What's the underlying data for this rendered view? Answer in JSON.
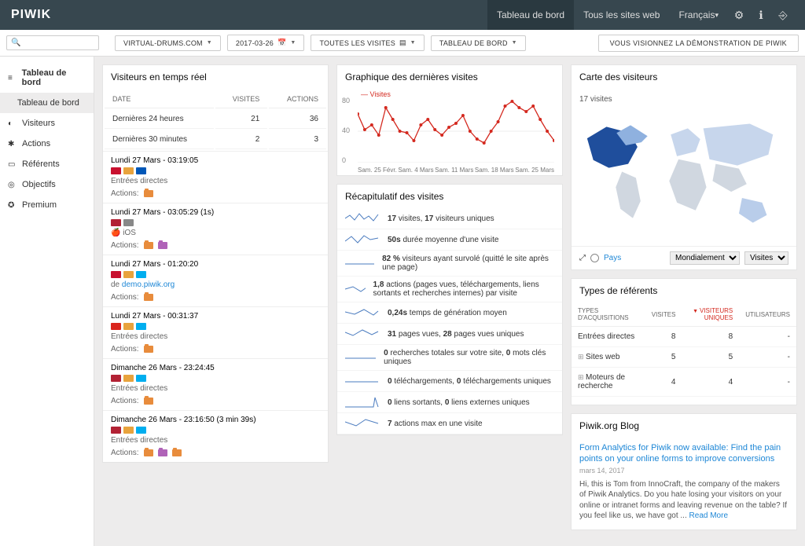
{
  "topbar": {
    "logo": "PIWIK",
    "items": [
      {
        "label": "Tableau de bord",
        "active": true
      },
      {
        "label": "Tous les sites web"
      },
      {
        "label": "Français"
      }
    ]
  },
  "toolbar": {
    "site": "VIRTUAL-DRUMS.COM",
    "date": "2017-03-26",
    "segment": "TOUTES LES VISITES",
    "dashboard": "TABLEAU DE BORD",
    "demo": "VOUS VISIONNEZ LA DÉMONSTRATION DE PIWIK"
  },
  "sidebar": {
    "items": [
      {
        "label": "Tableau de bord",
        "bold": true,
        "icon": "≡"
      },
      {
        "label": "Tableau de bord",
        "sub": true
      },
      {
        "label": "Visiteurs",
        "icon": "◐"
      },
      {
        "label": "Actions",
        "icon": "✱"
      },
      {
        "label": "Référents",
        "icon": "▭"
      },
      {
        "label": "Objectifs",
        "icon": "◎"
      },
      {
        "label": "Premium",
        "icon": "✪"
      }
    ]
  },
  "realtime": {
    "title": "Visiteurs en temps réel",
    "cols": {
      "date": "DATE",
      "visits": "VISITES",
      "actions": "ACTIONS"
    },
    "rows": [
      {
        "label": "Dernières 24 heures",
        "visits": 21,
        "actions": 36
      },
      {
        "label": "Dernières 30 minutes",
        "visits": 2,
        "actions": 3
      }
    ],
    "visits": [
      {
        "ts": "Lundi 27 Mars - 03:19:05",
        "src": "Entrées directes",
        "flags": [
          "#c8102e",
          "#e8a33d",
          "#0057b7"
        ],
        "folders": 1
      },
      {
        "ts": "Lundi 27 Mars - 03:05:29 (1s)",
        "src": "iOS",
        "src_icon": "🍎",
        "flags": [
          "#b22234",
          "#888"
        ],
        "folders": 2
      },
      {
        "ts": "Lundi 27 Mars - 01:20:20",
        "src_link": "demo.piwik.org",
        "src_prefix": "de ",
        "flags": [
          "#c8102e",
          "#e8a33d",
          "#00aeef"
        ],
        "folders": 1
      },
      {
        "ts": "Lundi 27 Mars - 00:31:37",
        "src": "Entrées directes",
        "flags": [
          "#da251d",
          "#e8a33d",
          "#00aeef"
        ],
        "folders": 1
      },
      {
        "ts": "Dimanche 26 Mars - 23:24:45",
        "src": "Entrées directes",
        "flags": [
          "#b22234",
          "#e8a33d",
          "#00aeef"
        ],
        "folders": 1
      },
      {
        "ts": "Dimanche 26 Mars - 23:16:50 (3 min 39s)",
        "src": "Entrées directes",
        "flags": [
          "#b22234",
          "#e8a33d",
          "#00aeef"
        ],
        "folders": 3
      }
    ],
    "actions_label": "Actions:"
  },
  "chart": {
    "title": "Graphique des dernières visites",
    "legend": "Visites",
    "y_ticks": [
      "80",
      "40",
      "0"
    ],
    "x_labels": [
      "Sam. 25 Févr.",
      "Sam. 4 Mars",
      "Sam. 11 Mars",
      "Sam. 18 Mars",
      "Sam. 25 Mars"
    ]
  },
  "chart_data": {
    "type": "line",
    "series": [
      {
        "name": "Visites",
        "color": "#d4291f",
        "values": [
          62,
          42,
          48,
          35,
          70,
          55,
          40,
          38,
          28,
          48,
          55,
          42,
          35,
          45,
          50,
          60,
          40,
          30,
          25,
          40,
          52,
          72,
          78,
          70,
          65,
          72,
          55,
          40,
          28
        ]
      }
    ],
    "ylim": [
      0,
      80
    ],
    "x_start": "2017-02-25",
    "x_end": "2017-03-25",
    "xlabel": "",
    "ylabel": ""
  },
  "summary": {
    "title": "Récapitulatif des visites",
    "rows": [
      {
        "text": "<b>17</b> visites, <b>17</b> visiteurs uniques"
      },
      {
        "text": "<b>50s</b> durée moyenne d'une visite"
      },
      {
        "text": "<b>82 %</b> visiteurs ayant survolé (quitté le site après une page)"
      },
      {
        "text": "<b>1,8</b> actions (pages vues, téléchargements, liens sortants et recherches internes) par visite"
      },
      {
        "text": "<b>0,24s</b> temps de génération moyen"
      },
      {
        "text": "<b>31</b> pages vues, <b>28</b> pages vues uniques"
      },
      {
        "text": "<b>0</b> recherches totales sur votre site, <b>0</b> mots clés uniques"
      },
      {
        "text": "<b>0</b> téléchargements, <b>0</b> téléchargements uniques"
      },
      {
        "text": "<b>0</b> liens sortants, <b>0</b> liens externes uniques"
      },
      {
        "text": "<b>7</b> actions max en une visite"
      }
    ]
  },
  "map": {
    "title": "Carte des visiteurs",
    "count_label": "17 visites",
    "country_label": "Pays",
    "scope_options": [
      "Mondialement"
    ],
    "metric_options": [
      "Visites"
    ]
  },
  "referrers": {
    "title": "Types de référents",
    "cols": {
      "type": "TYPES D'ACQUISITIONS",
      "visits": "VISITES",
      "uniq": "VISITEURS UNIQUES",
      "users": "UTILISATEURS"
    },
    "rows": [
      {
        "label": "Entrées directes",
        "visits": 8,
        "uniq": 8,
        "users": "-",
        "expandable": false
      },
      {
        "label": "Sites web",
        "visits": 5,
        "uniq": 5,
        "users": "-",
        "expandable": true
      },
      {
        "label": "Moteurs de recherche",
        "visits": 4,
        "uniq": 4,
        "users": "-",
        "expandable": true
      }
    ]
  },
  "blog": {
    "title": "Piwik.org Blog",
    "post_title": "Form Analytics for Piwik now available: Find the pain points on your online forms to improve conversions",
    "post_date": "mars 14, 2017",
    "excerpt": "Hi, this is Tom from InnoCraft, the company of the makers of Piwik Analytics. Do you hate losing your visitors on your online or intranet forms and leaving revenue on the table? If you feel like us, we have got ... ",
    "read_more": "Read More"
  }
}
